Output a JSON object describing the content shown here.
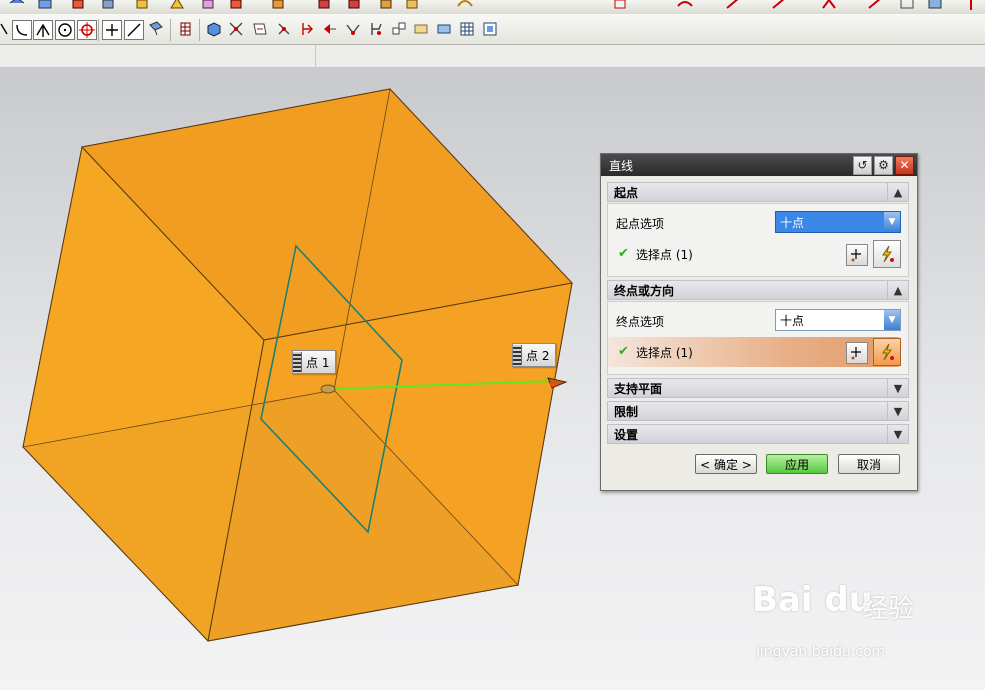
{
  "toolbar": {
    "row1_icons": [
      "view-icon",
      "layer-icon",
      "sketch-icon",
      "extrude-icon",
      "revolve-icon",
      "shade-icon",
      "feature-icon",
      "edit-icon",
      "trim-icon",
      "curve-icon",
      "spline-icon",
      "offset-icon",
      "arc-icon",
      "point-icon",
      "plane-icon",
      "measure-icon"
    ],
    "row2_icons": [
      "line-icon",
      "arc-curve-icon",
      "intersect-icon",
      "circle-icon",
      "crosshair-icon",
      "plus-icon",
      "slash-icon",
      "view-orient-icon",
      "grid-icon",
      "cube-icon",
      "transform-icon",
      "move-icon",
      "mirror-icon",
      "scale-icon",
      "align-icon",
      "dimension-icon",
      "surface-icon",
      "fill-icon",
      "table-icon",
      "window-icon"
    ]
  },
  "viewport": {
    "point_labels": [
      "点 1",
      "点 2"
    ],
    "colors": {
      "cube_light": "#f7a824",
      "cube_dark": "#a2772a",
      "line": "#5fe81a",
      "plane": "#1e8070"
    }
  },
  "dialog": {
    "title": "直线",
    "sections": {
      "start": {
        "header": "起点",
        "option_label": "起点选项",
        "option_value": "十点",
        "select_label": "选择点 (1)"
      },
      "end": {
        "header": "终点或方向",
        "option_label": "终点选项",
        "option_value": "十点",
        "select_label": "选择点 (1)"
      },
      "support": {
        "header": "支持平面"
      },
      "limits": {
        "header": "限制"
      },
      "settings": {
        "header": "设置"
      }
    },
    "buttons": {
      "ok": "< 确定 >",
      "apply": "应用",
      "cancel": "取消"
    }
  },
  "watermark": {
    "logo": "Bai du",
    "name": "经验",
    "url": "jingyan.baidu.com"
  }
}
